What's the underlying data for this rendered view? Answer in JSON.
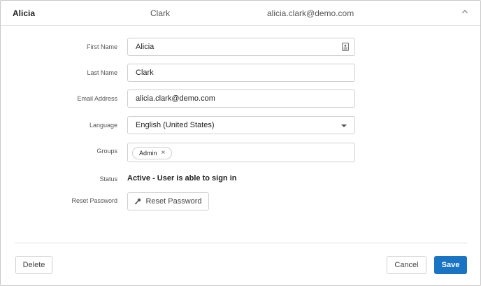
{
  "header": {
    "first_name": "Alicia",
    "last_name": "Clark",
    "email": "alicia.clark@demo.com",
    "toggle_icon": "chevron-up-icon"
  },
  "form": {
    "first_name": {
      "label": "First Name",
      "value": "Alicia",
      "icon": "contact-card-icon"
    },
    "last_name": {
      "label": "Last Name",
      "value": "Clark"
    },
    "email": {
      "label": "Email Address",
      "value": "alicia.clark@demo.com"
    },
    "language": {
      "label": "Language",
      "value": "English (United States)"
    },
    "groups": {
      "label": "Groups",
      "chips": [
        {
          "label": "Admin",
          "remove_glyph": "×"
        }
      ]
    },
    "status": {
      "label": "Status",
      "value": "Active - User is able to sign in"
    },
    "reset_password": {
      "label": "Reset Password",
      "button_label": "Reset Password",
      "icon": "key-icon"
    }
  },
  "footer": {
    "delete_label": "Delete",
    "cancel_label": "Cancel",
    "save_label": "Save"
  },
  "colors": {
    "primary": "#1a74c4",
    "border": "#cfcfcf"
  }
}
